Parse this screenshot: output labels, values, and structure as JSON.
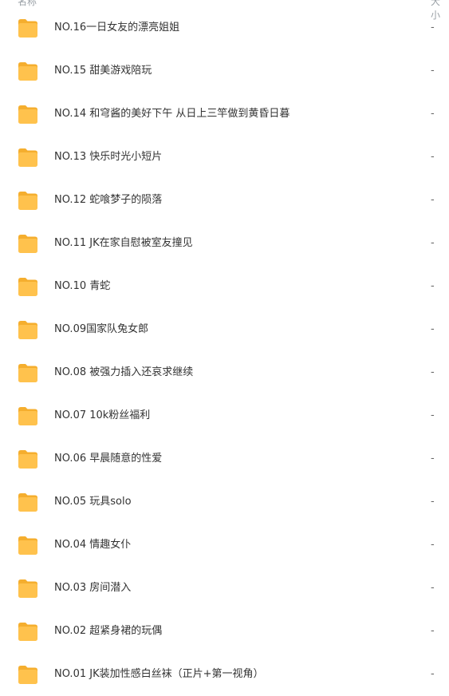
{
  "header": {
    "name_label": "名称",
    "size_label": "大小"
  },
  "colors": {
    "folder": "#FFC24D",
    "folder_tab": "#F5AE2E"
  },
  "files": [
    {
      "name": "NO.16一日女友的漂亮姐姐",
      "size": "-",
      "icon": "folder-icon"
    },
    {
      "name": "NO.15 甜美游戏陪玩",
      "size": "-",
      "icon": "folder-icon"
    },
    {
      "name": "NO.14 和穹酱的美好下午 从日上三竿做到黄昏日暮",
      "size": "-",
      "icon": "folder-icon"
    },
    {
      "name": "NO.13 快乐时光小短片",
      "size": "-",
      "icon": "folder-icon"
    },
    {
      "name": "NO.12 蛇喰梦子的陨落",
      "size": "-",
      "icon": "folder-icon"
    },
    {
      "name": "NO.11 JK在家自慰被室友撞见",
      "size": "-",
      "icon": "folder-icon"
    },
    {
      "name": "NO.10 青蛇",
      "size": "-",
      "icon": "folder-icon"
    },
    {
      "name": "NO.09国家队兔女郎",
      "size": "-",
      "icon": "folder-icon"
    },
    {
      "name": "NO.08 被强力插入还哀求继续",
      "size": "-",
      "icon": "folder-icon"
    },
    {
      "name": "NO.07 10k粉丝福利",
      "size": "-",
      "icon": "folder-icon"
    },
    {
      "name": "NO.06 早晨随意的性爱",
      "size": "-",
      "icon": "folder-icon"
    },
    {
      "name": "NO.05 玩具solo",
      "size": "-",
      "icon": "folder-icon"
    },
    {
      "name": "NO.04 情趣女仆",
      "size": "-",
      "icon": "folder-icon"
    },
    {
      "name": "NO.03 房间潜入",
      "size": "-",
      "icon": "folder-icon"
    },
    {
      "name": "NO.02 超紧身裙的玩偶",
      "size": "-",
      "icon": "folder-icon"
    },
    {
      "name": "NO.01 JK装加性感白丝袜（正片+第一视角）",
      "size": "-",
      "icon": "folder-icon"
    }
  ]
}
